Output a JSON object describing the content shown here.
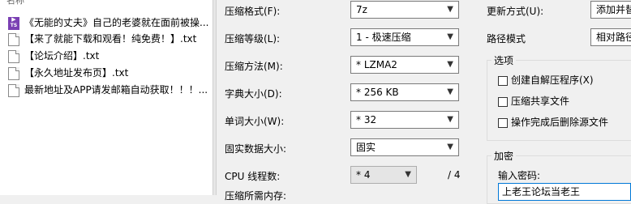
{
  "file_list": {
    "header": "名称",
    "items": [
      {
        "name": "《无能的丈夫》自己的老婆就在面前被操...",
        "icon": "ts-video-icon"
      },
      {
        "name": "【来了就能下载和观看！纯免费！】.txt",
        "icon": "text-file-icon"
      },
      {
        "name": "【论坛介绍】.txt",
        "icon": "text-file-icon"
      },
      {
        "name": "【永久地址发布页】.txt",
        "icon": "text-file-icon"
      },
      {
        "name": "最新地址及APP请发邮箱自动获取！！！...",
        "icon": "text-file-icon"
      }
    ]
  },
  "options": {
    "format_label": "压缩格式(F):",
    "format_value": "7z",
    "level_label": "压缩等级(L):",
    "level_value": "1 - 极速压缩",
    "method_label": "压缩方法(M):",
    "method_value": "* LZMA2",
    "dict_label": "字典大小(D):",
    "dict_value": "* 256 KB",
    "word_label": "单词大小(W):",
    "word_value": "* 32",
    "solid_label": "固实数据大小:",
    "solid_value": "固实",
    "threads_label": "CPU 线程数:",
    "threads_value": "* 4",
    "threads_total": "/ 4",
    "memory_label": "压缩所需内存:"
  },
  "right": {
    "update_label": "更新方式(U):",
    "update_value": "添加并替换文件",
    "path_label": "路径模式",
    "path_value": "相对路径",
    "options_group": "选项",
    "sfx_label": "创建自解压程序(X)",
    "shared_label": "压缩共享文件",
    "delete_label": "操作完成后删除源文件",
    "encrypt_group": "加密",
    "password_label": "输入密码:",
    "password_value": "上老王论坛当老王"
  }
}
